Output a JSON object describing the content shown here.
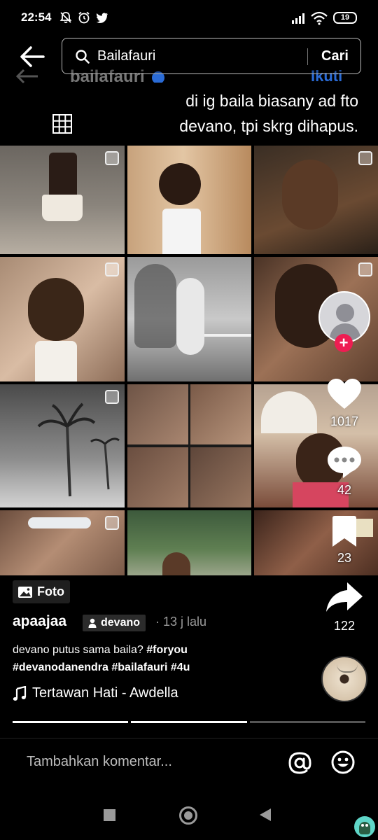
{
  "status": {
    "time": "22:54",
    "battery": "19"
  },
  "search": {
    "query": "Bailafauri",
    "action_label": "Cari"
  },
  "profile_header": {
    "username": "bailafauri",
    "follow_label": "Ikuti"
  },
  "overlay_caption": {
    "line1": "di ig baila biasany ad fto",
    "line2": "devano, tpi skrg dihapus."
  },
  "actions": {
    "likes": "1017",
    "comments": "42",
    "saves": "23",
    "shares": "122"
  },
  "post": {
    "badge_label": "Foto",
    "author": "apaajaa",
    "creator_tag": "devano",
    "time_ago": "· 13 j lalu",
    "description_text": "devano putus sama baila?",
    "hashtags_line1": "#foryou",
    "hashtags_line2": "#devanodanendra #bailafauri #4u",
    "music": "Tertawan Hati - Awdella"
  },
  "slides": {
    "total": 3,
    "current": 2
  },
  "comment": {
    "placeholder": "Tambahkan komentar..."
  },
  "colors": {
    "background": "#000000",
    "accent_red": "#ee1d52",
    "verified_blue": "#2a6bd6"
  }
}
